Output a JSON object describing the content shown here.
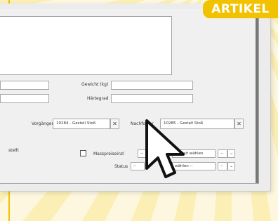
{
  "badge": {
    "label": "ARTIKEL"
  },
  "form": {
    "gewicht_label": "Gewicht (kg)",
    "haertegrad_label": "Härtegrad",
    "vorgaenger_label": "Vorgänger",
    "vorgaenger_value": "10284 - Gestell Stoß",
    "nachfolger_label": "Nachfolger",
    "nachfolger_value": "10285 - Gestell Stoß",
    "stellt_label": "stellt",
    "masspreis_label": "Masspreiseinzl",
    "masspreis_value": "-- ",
    "masspreis_right_value": "Einheit wählen",
    "status_label": "Status",
    "status_value": "-- ",
    "status_right_value": "wählen --",
    "small_select_value": "--",
    "remove_symbol": "✕",
    "dropdown_symbol": "⌄"
  },
  "colors": {
    "accent": "#f2c200",
    "panel": "#ececec"
  },
  "icons": {
    "cursor": "arrow-cursor-icon"
  }
}
